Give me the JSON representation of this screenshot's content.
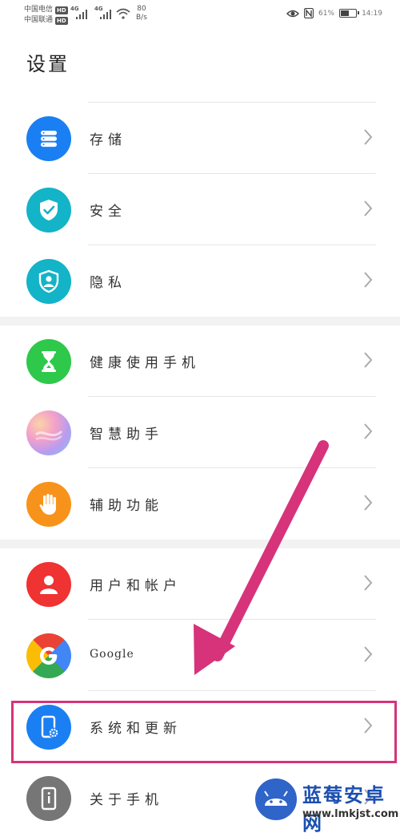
{
  "status_bar": {
    "carrier1": "中国电信",
    "carrier2": "中国联通",
    "hd": "HD",
    "network1": "4G",
    "network2": "4G",
    "speed_value": "80",
    "speed_unit": "B/s",
    "battery_percent": "61%",
    "battery_level": 0.61,
    "time": "14:19"
  },
  "page": {
    "title": "设置"
  },
  "settings": {
    "items": [
      {
        "label": "存储",
        "icon": "storage-icon",
        "color": "#1a7ff2"
      },
      {
        "label": "安全",
        "icon": "shield-check-icon",
        "color": "#13b3c8"
      },
      {
        "label": "隐私",
        "icon": "privacy-icon",
        "color": "#13b3c8"
      },
      {
        "label": "健康使用手机",
        "icon": "hourglass-icon",
        "color": "#2ec84a"
      },
      {
        "label": "智慧助手",
        "icon": "assistant-icon",
        "color": "#e98fc6"
      },
      {
        "label": "辅助功能",
        "icon": "hand-icon",
        "color": "#f7931a"
      },
      {
        "label": "用户和帐户",
        "icon": "user-icon",
        "color": "#ef3232"
      },
      {
        "label": "Google",
        "icon": "google-icon",
        "color": "#4285f4"
      },
      {
        "label": "系统和更新",
        "icon": "system-update-icon",
        "color": "#1a7ff2"
      },
      {
        "label": "关于手机",
        "icon": "phone-info-icon",
        "color": "#767676"
      }
    ]
  },
  "annotation": {
    "highlight_color": "#d6337a"
  },
  "watermark": {
    "title": "蓝莓安卓网",
    "url": "www.lmkjst.com"
  }
}
